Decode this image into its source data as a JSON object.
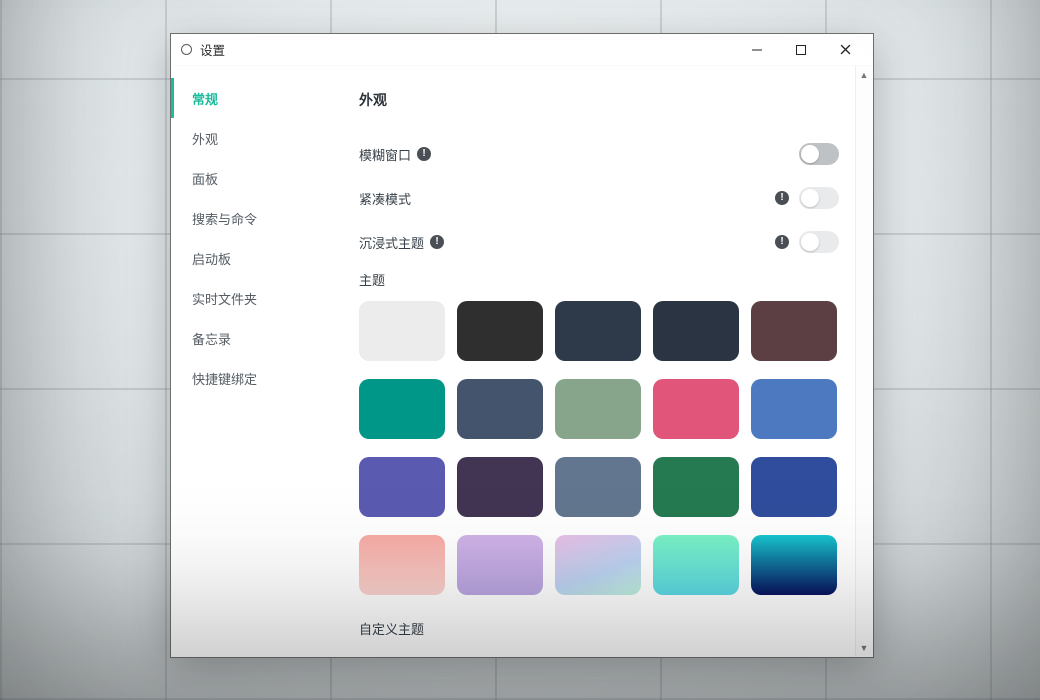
{
  "window": {
    "title": "设置"
  },
  "sidebar": {
    "items": [
      {
        "label": "常规",
        "active": true
      },
      {
        "label": "外观"
      },
      {
        "label": "面板"
      },
      {
        "label": "搜索与命令"
      },
      {
        "label": "启动板"
      },
      {
        "label": "实时文件夹"
      },
      {
        "label": "备忘录"
      },
      {
        "label": "快捷键绑定"
      }
    ]
  },
  "main": {
    "section_title": "外观",
    "rows": {
      "blur_window": {
        "label": "模糊窗口",
        "info": true,
        "info_trailing": false,
        "toggle": "off-grey"
      },
      "compact": {
        "label": "紧凑模式",
        "info": false,
        "info_trailing": true,
        "toggle": "off-light"
      },
      "immersive": {
        "label": "沉浸式主题",
        "info": true,
        "info_trailing": true,
        "toggle": "off-light"
      }
    },
    "theme_label": "主题",
    "custom_theme_label": "自定义主题",
    "swatches": [
      {
        "name": "light",
        "css": "background:#ececec;"
      },
      {
        "name": "charcoal",
        "css": "background:#2f2f2f;"
      },
      {
        "name": "slate-navy",
        "css": "background:#2e3a4a;"
      },
      {
        "name": "navy-dark",
        "css": "background:#2b3442;"
      },
      {
        "name": "maroon",
        "css": "background:#5c3f43;"
      },
      {
        "name": "teal",
        "css": "background:#009688;"
      },
      {
        "name": "slate-blue",
        "css": "background:#45546d;"
      },
      {
        "name": "sage",
        "css": "background:#86a58a;"
      },
      {
        "name": "pink",
        "css": "background:#e05579;"
      },
      {
        "name": "azure",
        "css": "background:#4c79c0;"
      },
      {
        "name": "indigo",
        "css": "background:#5a5ab1;"
      },
      {
        "name": "plum",
        "css": "background:#423453;"
      },
      {
        "name": "steel",
        "css": "background:#62768f;"
      },
      {
        "name": "forest",
        "css": "background:#257a52;"
      },
      {
        "name": "royal",
        "css": "background:#2f4d9c;"
      },
      {
        "name": "grad-blush",
        "css": "background:linear-gradient(180deg,#f7aaa4 0%,#fbd4cf 100%);"
      },
      {
        "name": "grad-lilac",
        "css": "background:linear-gradient(180deg,#d0b3e8 0%,#b9a5e0 100%);"
      },
      {
        "name": "grad-pastel",
        "css": "background:linear-gradient(160deg,#e9bfe5 0%,#bcd3f2 60%,#bff0dd 100%);"
      },
      {
        "name": "grad-mint",
        "css": "background:linear-gradient(180deg,#7af2c4 0%,#5cd8e4 100%);"
      },
      {
        "name": "grad-ocean",
        "css": "background:linear-gradient(180deg,#17c6cf 0%,#0a1260 100%);"
      }
    ]
  }
}
